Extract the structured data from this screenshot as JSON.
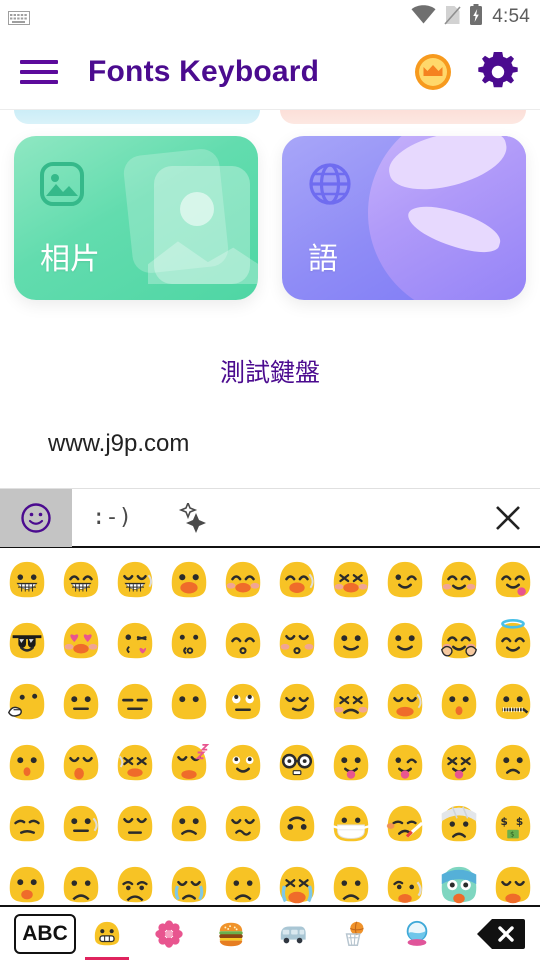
{
  "statusbar": {
    "keyboard_icon": "keyboard-icon",
    "wifi_icon": "wifi-icon",
    "sim_off_icon": "sim-off-icon",
    "battery_charging_icon": "battery-charging-icon",
    "time": "4:54"
  },
  "appbar": {
    "menu_icon": "hamburger-menu-icon",
    "title": "Fonts Keyboard",
    "premium_icon": "crown-coin-icon",
    "settings_icon": "gear-icon",
    "title_color": "#4b0b8f",
    "accent_color": "#5c0b9b"
  },
  "content": {
    "peek_cards": [
      {
        "name": "peek-card-blue",
        "color": "#bfe9f5"
      },
      {
        "name": "peek-card-pink",
        "color": "#fad6cf"
      }
    ],
    "cards": [
      {
        "name": "photos-card",
        "label": "相片",
        "icon": "image-icon",
        "color": "#4fd6a4"
      },
      {
        "name": "language-card",
        "label": "語",
        "icon": "globe-icon",
        "color": "#7c78f5"
      }
    ],
    "test_title": "測試鍵盤",
    "url_text": "www.j9p.com"
  },
  "suggestion_bar": {
    "emoji_toggle_icon": "smiley-face-icon",
    "suggestions": [
      {
        "name": "suggestion-smiley-text",
        "text": ":-)"
      },
      {
        "name": "suggestion-sparkles",
        "text": "✦✦"
      }
    ],
    "close_icon": "close-icon"
  },
  "emoji_grid": {
    "columns": 10,
    "rows": [
      [
        {
          "n": "grinning",
          "e": "grin-teeth"
        },
        {
          "n": "beaming",
          "e": "grin-teeth-smileeyes"
        },
        {
          "n": "grinning-squinting",
          "e": "grin-teeth-closedeyes"
        },
        {
          "n": "smiling-open",
          "e": "open-smile"
        },
        {
          "n": "smiling-blush",
          "e": "open-smile-blush"
        },
        {
          "n": "laughing-tear",
          "e": "open-smile-tear"
        },
        {
          "n": "squinting-laugh",
          "e": "open-smile-xeyes"
        },
        {
          "n": "winking",
          "e": "wink"
        },
        {
          "n": "smiling-blush-closed",
          "e": "smile-blush"
        },
        {
          "n": "yum-tongue",
          "e": "smile-tongue"
        }
      ],
      [
        {
          "n": "sunglasses",
          "e": "sunglasses"
        },
        {
          "n": "heart-eyes",
          "e": "heart-eyes"
        },
        {
          "n": "blowing-kiss",
          "e": "kiss-heart"
        },
        {
          "n": "kissing",
          "e": "kiss"
        },
        {
          "n": "kissing-smile-eyes",
          "e": "kiss-smileeyes"
        },
        {
          "n": "kissing-closed-eyes",
          "e": "kiss-closedeyes"
        },
        {
          "n": "slight-smile-a",
          "e": "slight-smile"
        },
        {
          "n": "slight-smile-b",
          "e": "slight-smile"
        },
        {
          "n": "hugging",
          "e": "hug-hands"
        },
        {
          "n": "halo-angel",
          "e": "halo"
        }
      ],
      [
        {
          "n": "thinking",
          "e": "thinking-hand"
        },
        {
          "n": "neutral",
          "e": "neutral"
        },
        {
          "n": "expressionless",
          "e": "expressionless"
        },
        {
          "n": "no-mouth",
          "e": "no-mouth"
        },
        {
          "n": "rolling-eyes",
          "e": "roll-eyes"
        },
        {
          "n": "smirking",
          "e": "smirk"
        },
        {
          "n": "persevering",
          "e": "persevere"
        },
        {
          "n": "disappointed-relieved",
          "e": "sad-sweat"
        },
        {
          "n": "open-mouth",
          "e": "open-mouth"
        },
        {
          "n": "zipper-mouth",
          "e": "zipper"
        }
      ],
      [
        {
          "n": "hushed",
          "e": "open-mouth"
        },
        {
          "n": "sleepy",
          "e": "sleepy-drop"
        },
        {
          "n": "tired-face",
          "e": "tired"
        },
        {
          "n": "sleeping",
          "e": "sleeping-zzz"
        },
        {
          "n": "relieved",
          "e": "relieved"
        },
        {
          "n": "nerd-face",
          "e": "nerd-glasses"
        },
        {
          "n": "tongue-out",
          "e": "tongue"
        },
        {
          "n": "tongue-wink",
          "e": "tongue-wink"
        },
        {
          "n": "tongue-squint",
          "e": "tongue-squint"
        },
        {
          "n": "unamused-frown",
          "e": "frown"
        }
      ],
      [
        {
          "n": "unamused",
          "e": "unamused"
        },
        {
          "n": "sweat",
          "e": "neutral-sweat"
        },
        {
          "n": "pensive",
          "e": "pensive"
        },
        {
          "n": "confused",
          "e": "confused"
        },
        {
          "n": "confounded",
          "e": "confounded"
        },
        {
          "n": "upside-down",
          "e": "upside-down"
        },
        {
          "n": "mask",
          "e": "medical-mask"
        },
        {
          "n": "thermometer-face",
          "e": "thermometer"
        },
        {
          "n": "head-bandage",
          "e": "bandage"
        },
        {
          "n": "money-mouth",
          "e": "money-mouth"
        }
      ],
      [
        {
          "n": "astonished",
          "e": "astonished"
        },
        {
          "n": "frowning-open",
          "e": "frown-open"
        },
        {
          "n": "anguished",
          "e": "anguished"
        },
        {
          "n": "crying-face",
          "e": "crying"
        },
        {
          "n": "frowning-big",
          "e": "frown-open"
        },
        {
          "n": "loudly-crying",
          "e": "loudly-crying"
        },
        {
          "n": "open-frown",
          "e": "frown-open"
        },
        {
          "n": "worried-sweat",
          "e": "worried-sweat"
        },
        {
          "n": "screaming",
          "e": "screaming"
        },
        {
          "n": "weary",
          "e": "weary"
        }
      ]
    ]
  },
  "bottom_nav": {
    "abc_label": "ABC",
    "tabs": [
      {
        "name": "tab-smileys",
        "icon": "grinning-emoji-icon",
        "active": true
      },
      {
        "name": "tab-nature",
        "icon": "flower-icon",
        "active": false
      },
      {
        "name": "tab-food",
        "icon": "hamburger-icon",
        "active": false
      },
      {
        "name": "tab-travel",
        "icon": "van-icon",
        "active": false
      },
      {
        "name": "tab-activity",
        "icon": "basketball-hoop-icon",
        "active": false
      },
      {
        "name": "tab-objects",
        "icon": "crystal-ball-icon",
        "active": false
      }
    ],
    "delete_icon": "backspace-icon",
    "active_indicator_color": "#e0245e"
  }
}
